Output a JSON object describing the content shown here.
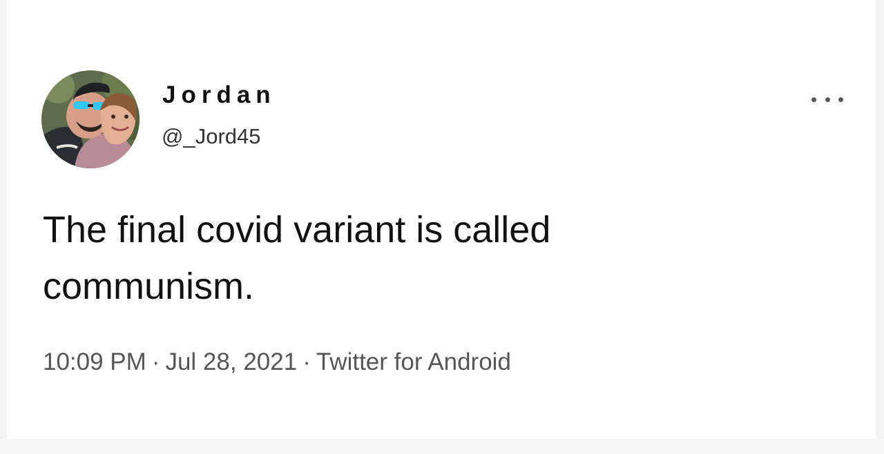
{
  "author": {
    "name": "Jordan",
    "handle": "@_Jord45",
    "avatar_icon": "profile-photo-couple"
  },
  "more_button": {
    "icon": "more-dots-icon"
  },
  "tweet": {
    "text_lines": [
      "The final covid variant is called",
      "communism."
    ]
  },
  "meta": {
    "time": "10:09 PM",
    "separator": "·",
    "date": "Jul 28, 2021",
    "source": "Twitter for Android"
  },
  "colors": {
    "background": "#ffffff",
    "text": "#111111",
    "secondary_text": "#555555"
  }
}
